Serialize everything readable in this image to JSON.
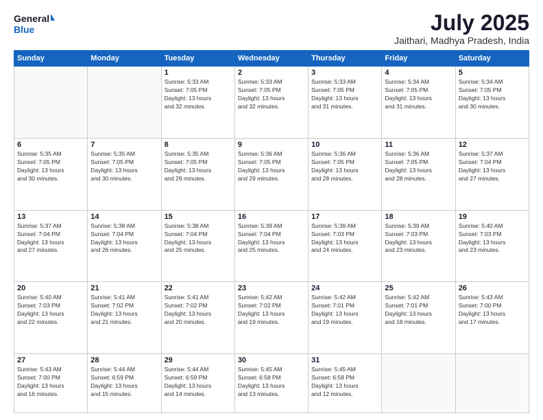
{
  "header": {
    "logo_line1": "General",
    "logo_line2": "Blue",
    "month": "July 2025",
    "location": "Jaithari, Madhya Pradesh, India"
  },
  "weekdays": [
    "Sunday",
    "Monday",
    "Tuesday",
    "Wednesday",
    "Thursday",
    "Friday",
    "Saturday"
  ],
  "weeks": [
    [
      {
        "day": "",
        "info": ""
      },
      {
        "day": "",
        "info": ""
      },
      {
        "day": "1",
        "info": "Sunrise: 5:33 AM\nSunset: 7:05 PM\nDaylight: 13 hours\nand 32 minutes."
      },
      {
        "day": "2",
        "info": "Sunrise: 5:33 AM\nSunset: 7:05 PM\nDaylight: 13 hours\nand 32 minutes."
      },
      {
        "day": "3",
        "info": "Sunrise: 5:33 AM\nSunset: 7:05 PM\nDaylight: 13 hours\nand 31 minutes."
      },
      {
        "day": "4",
        "info": "Sunrise: 5:34 AM\nSunset: 7:05 PM\nDaylight: 13 hours\nand 31 minutes."
      },
      {
        "day": "5",
        "info": "Sunrise: 5:34 AM\nSunset: 7:05 PM\nDaylight: 13 hours\nand 30 minutes."
      }
    ],
    [
      {
        "day": "6",
        "info": "Sunrise: 5:35 AM\nSunset: 7:05 PM\nDaylight: 13 hours\nand 30 minutes."
      },
      {
        "day": "7",
        "info": "Sunrise: 5:35 AM\nSunset: 7:05 PM\nDaylight: 13 hours\nand 30 minutes."
      },
      {
        "day": "8",
        "info": "Sunrise: 5:35 AM\nSunset: 7:05 PM\nDaylight: 13 hours\nand 29 minutes."
      },
      {
        "day": "9",
        "info": "Sunrise: 5:36 AM\nSunset: 7:05 PM\nDaylight: 13 hours\nand 29 minutes."
      },
      {
        "day": "10",
        "info": "Sunrise: 5:36 AM\nSunset: 7:05 PM\nDaylight: 13 hours\nand 28 minutes."
      },
      {
        "day": "11",
        "info": "Sunrise: 5:36 AM\nSunset: 7:05 PM\nDaylight: 13 hours\nand 28 minutes."
      },
      {
        "day": "12",
        "info": "Sunrise: 5:37 AM\nSunset: 7:04 PM\nDaylight: 13 hours\nand 27 minutes."
      }
    ],
    [
      {
        "day": "13",
        "info": "Sunrise: 5:37 AM\nSunset: 7:04 PM\nDaylight: 13 hours\nand 27 minutes."
      },
      {
        "day": "14",
        "info": "Sunrise: 5:38 AM\nSunset: 7:04 PM\nDaylight: 13 hours\nand 26 minutes."
      },
      {
        "day": "15",
        "info": "Sunrise: 5:38 AM\nSunset: 7:04 PM\nDaylight: 13 hours\nand 25 minutes."
      },
      {
        "day": "16",
        "info": "Sunrise: 5:39 AM\nSunset: 7:04 PM\nDaylight: 13 hours\nand 25 minutes."
      },
      {
        "day": "17",
        "info": "Sunrise: 5:39 AM\nSunset: 7:03 PM\nDaylight: 13 hours\nand 24 minutes."
      },
      {
        "day": "18",
        "info": "Sunrise: 5:39 AM\nSunset: 7:03 PM\nDaylight: 13 hours\nand 23 minutes."
      },
      {
        "day": "19",
        "info": "Sunrise: 5:40 AM\nSunset: 7:03 PM\nDaylight: 13 hours\nand 23 minutes."
      }
    ],
    [
      {
        "day": "20",
        "info": "Sunrise: 5:40 AM\nSunset: 7:03 PM\nDaylight: 13 hours\nand 22 minutes."
      },
      {
        "day": "21",
        "info": "Sunrise: 5:41 AM\nSunset: 7:02 PM\nDaylight: 13 hours\nand 21 minutes."
      },
      {
        "day": "22",
        "info": "Sunrise: 5:41 AM\nSunset: 7:02 PM\nDaylight: 13 hours\nand 20 minutes."
      },
      {
        "day": "23",
        "info": "Sunrise: 5:42 AM\nSunset: 7:02 PM\nDaylight: 13 hours\nand 19 minutes."
      },
      {
        "day": "24",
        "info": "Sunrise: 5:42 AM\nSunset: 7:01 PM\nDaylight: 13 hours\nand 19 minutes."
      },
      {
        "day": "25",
        "info": "Sunrise: 5:42 AM\nSunset: 7:01 PM\nDaylight: 13 hours\nand 18 minutes."
      },
      {
        "day": "26",
        "info": "Sunrise: 5:43 AM\nSunset: 7:00 PM\nDaylight: 13 hours\nand 17 minutes."
      }
    ],
    [
      {
        "day": "27",
        "info": "Sunrise: 5:43 AM\nSunset: 7:00 PM\nDaylight: 13 hours\nand 16 minutes."
      },
      {
        "day": "28",
        "info": "Sunrise: 5:44 AM\nSunset: 6:59 PM\nDaylight: 13 hours\nand 15 minutes."
      },
      {
        "day": "29",
        "info": "Sunrise: 5:44 AM\nSunset: 6:59 PM\nDaylight: 13 hours\nand 14 minutes."
      },
      {
        "day": "30",
        "info": "Sunrise: 5:45 AM\nSunset: 6:58 PM\nDaylight: 13 hours\nand 13 minutes."
      },
      {
        "day": "31",
        "info": "Sunrise: 5:45 AM\nSunset: 6:58 PM\nDaylight: 13 hours\nand 12 minutes."
      },
      {
        "day": "",
        "info": ""
      },
      {
        "day": "",
        "info": ""
      }
    ]
  ]
}
